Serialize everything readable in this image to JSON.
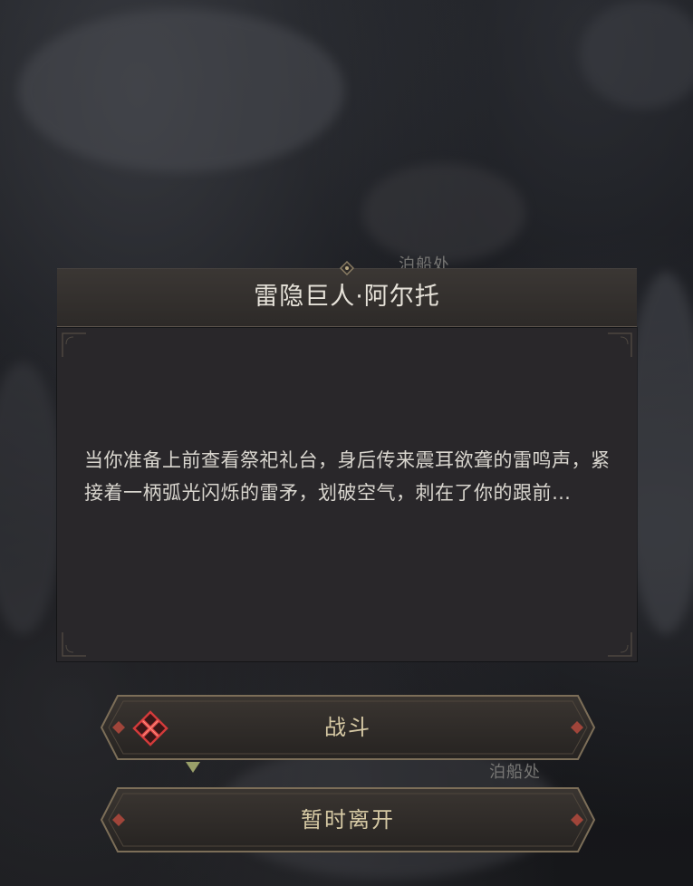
{
  "map": {
    "labels": [
      "泊船处",
      "泊船处"
    ]
  },
  "dialog": {
    "title": "雷隐巨人·阿尔托",
    "body": "当你准备上前查看祭祀礼台，身后传来震耳欲聋的雷鸣声，紧接着一柄弧光闪烁的雷矛，划破空气，刺在了你的跟前…"
  },
  "choices": [
    {
      "label": "战斗",
      "icon": "crossed-swords-icon"
    },
    {
      "label": "暂时离开"
    }
  ],
  "colors": {
    "accent_gold": "#d6c9a4",
    "danger_red": "#d23a3a",
    "panel_bg": "#29272a"
  }
}
